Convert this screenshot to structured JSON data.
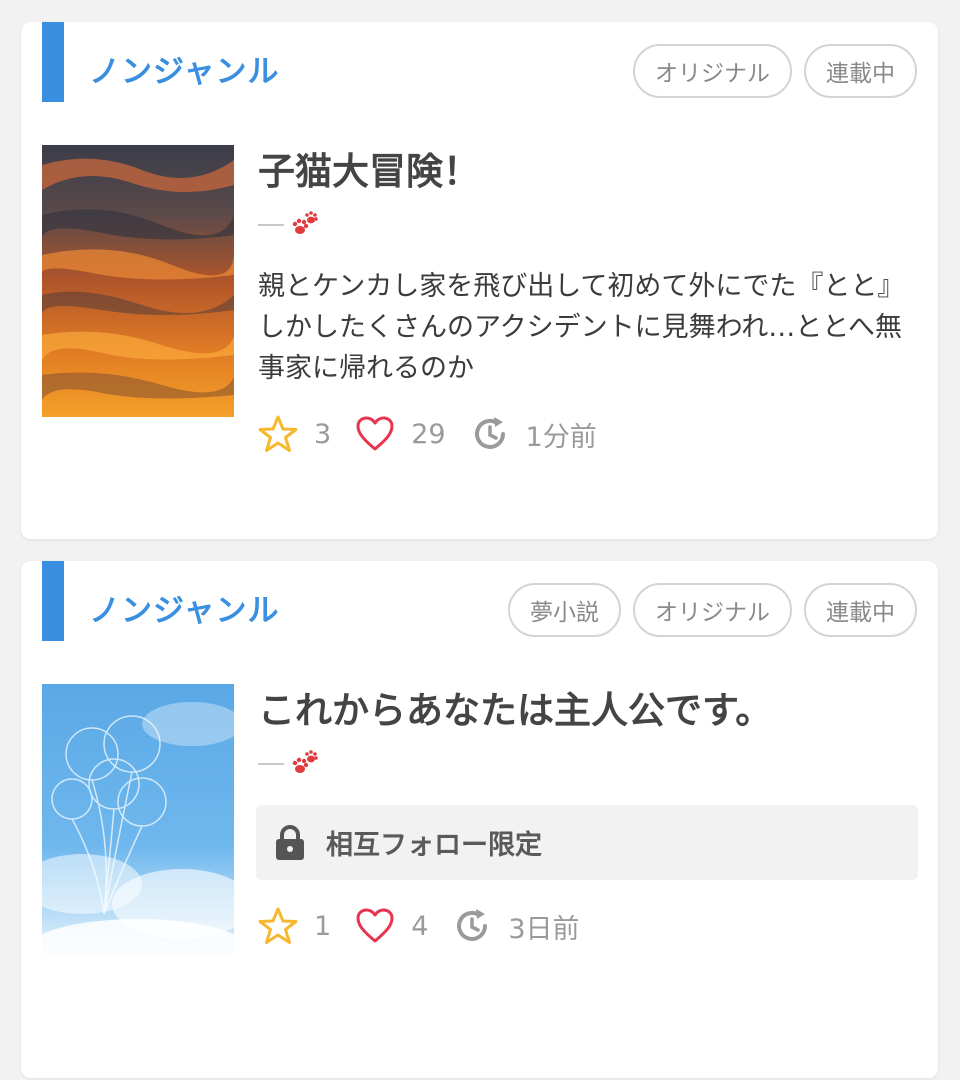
{
  "colors": {
    "accent": "#3a8fe0",
    "star": "#f5b82e",
    "heart": "#e8344e",
    "muted": "#9a9a9a"
  },
  "cards": [
    {
      "genre": "ノンジャンル",
      "tags": [
        "オリジナル",
        "連載中"
      ],
      "title": "子猫大冒険！",
      "author_icon": "paw-icon",
      "description": "親とケンカし家を飛び出して初めて外にでた『とと』しかしたくさんのアクシデントに見舞われ…ととへ無事家に帰れるのか",
      "cover": "sunset-clouds-image",
      "stats": {
        "stars": "3",
        "likes": "29",
        "updated": "1分前"
      }
    },
    {
      "genre": "ノンジャンル",
      "tags": [
        "夢小説",
        "オリジナル",
        "連載中"
      ],
      "title": "これからあなたは主人公です。",
      "author_icon": "paw-icon",
      "restriction": "相互フォロー限定",
      "cover": "balloons-sky-image",
      "stats": {
        "stars": "1",
        "likes": "4",
        "updated": "3日前"
      }
    }
  ]
}
